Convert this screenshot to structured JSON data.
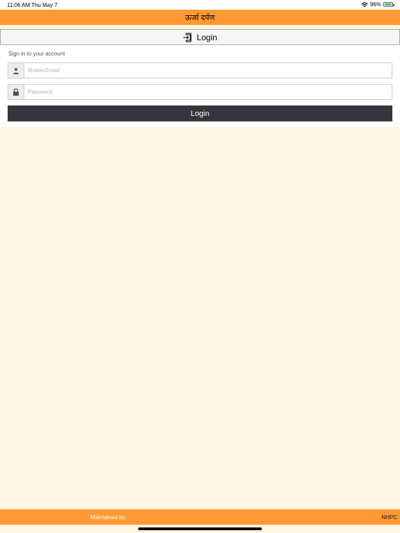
{
  "status_bar": {
    "time": "11:06 AM",
    "date": "Thu May 7",
    "battery": "96%"
  },
  "header": {
    "title": "ऊर्जा दर्पण"
  },
  "panel": {
    "title": "Login",
    "subtitle": "Sign in to your account",
    "mobile_placeholder": "Mobile/Email",
    "password_placeholder": "Password",
    "login_button": "Login"
  },
  "footer": {
    "maintained_by": "Maintained by:",
    "org": "NHPC"
  },
  "colors": {
    "header": "#ff9933",
    "background": "#fff3e1",
    "button": "#33363d"
  },
  "icons": [
    "wifi-icon",
    "battery-icon",
    "login-icon",
    "user-icon",
    "lock-icon"
  ]
}
